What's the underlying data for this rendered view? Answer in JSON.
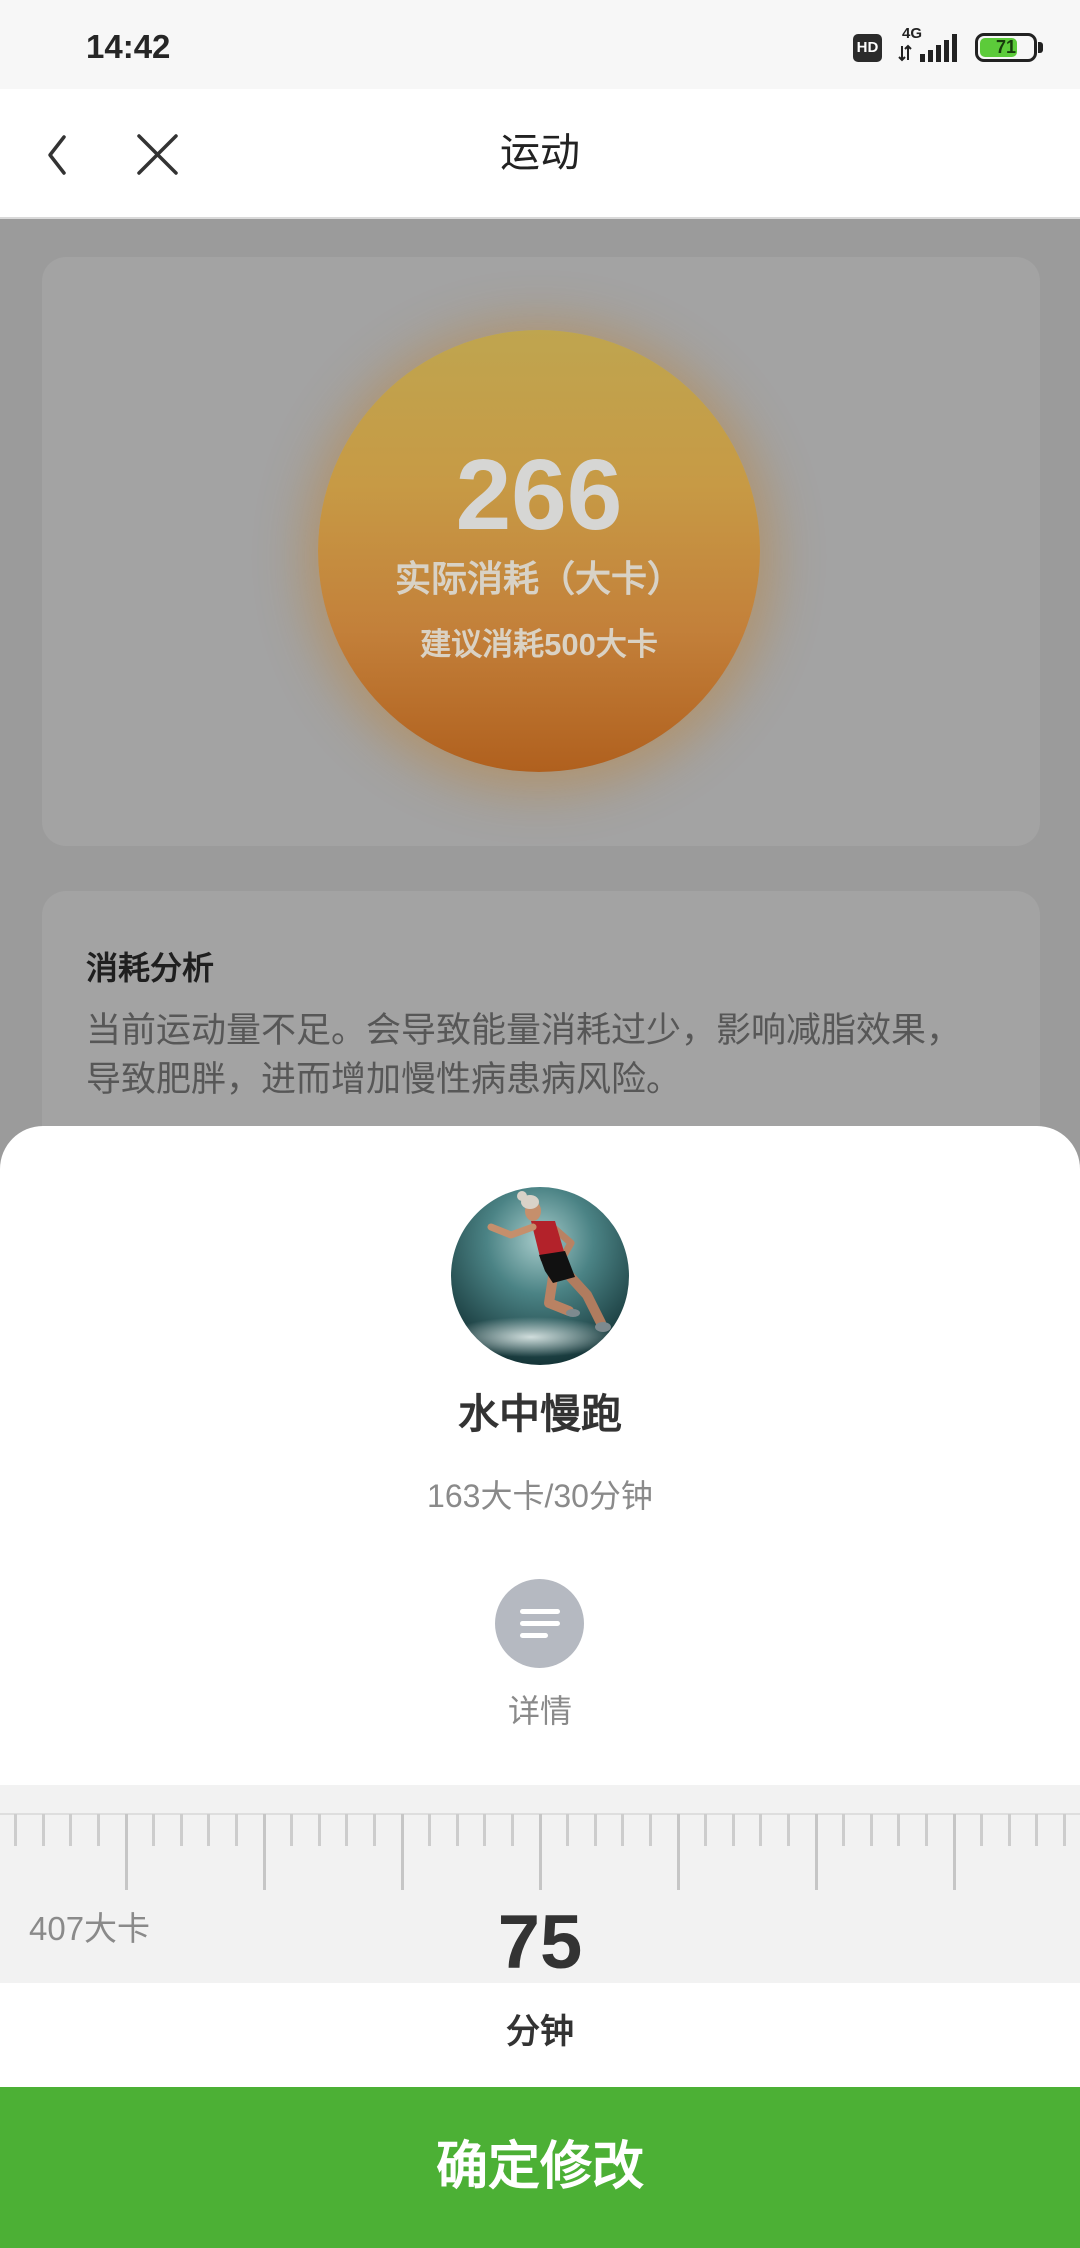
{
  "status_bar": {
    "time": "14:42",
    "hd_label": "HD",
    "network_label": "4G",
    "data_arrows_icon": "data-transfer-arrows-icon",
    "signal_icon": "cellular-signal-icon",
    "battery_level": "71"
  },
  "header": {
    "title": "运动",
    "back_icon": "chevron-left-icon",
    "close_icon": "close-icon"
  },
  "summary_card": {
    "calories_actual": "266",
    "calories_label": "实际消耗（大卡）",
    "suggestion": "建议消耗500大卡"
  },
  "analysis_card": {
    "title": "消耗分析",
    "lines": [
      "当前运动量不足。会导致能量消耗过少，影响减脂效果，",
      "导致肥胖，进而增加慢性病患病风险。"
    ]
  },
  "exercise_sheet": {
    "avatar_icon": "underwater-runner-photo",
    "name": "水中慢跑",
    "rate": "163大卡/30分钟",
    "details_icon": "details-list-icon",
    "details_label": "详情",
    "calories_estimate": "407大卡",
    "duration_value": "75",
    "duration_unit": "分钟",
    "confirm_label": "确定修改"
  },
  "colors": {
    "confirm_green": "#4cb035",
    "details_icon_bg": "#b5b9c1",
    "battery_green": "#5ccb3a",
    "calorie_circle_top": "#bfa54f",
    "calorie_circle_bottom": "#b0601e"
  }
}
